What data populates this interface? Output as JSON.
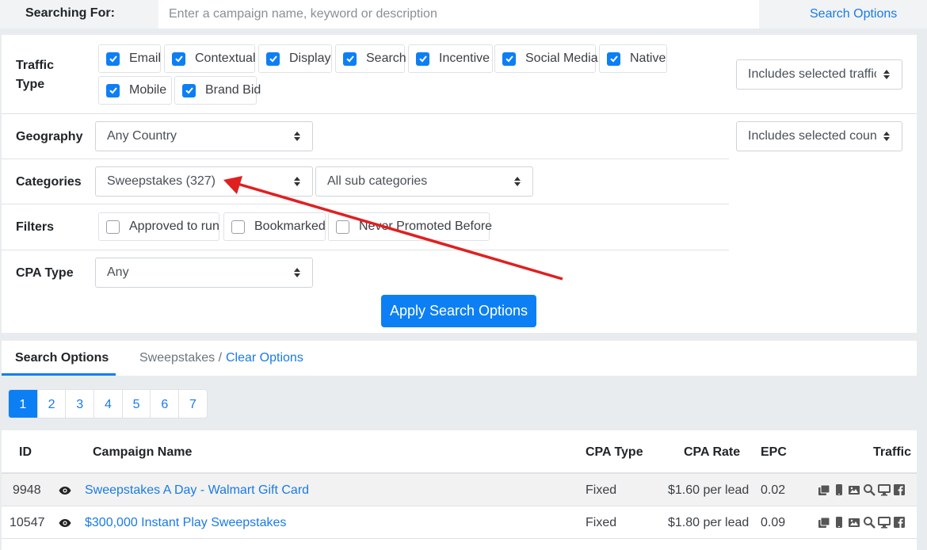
{
  "search_bar": {
    "label": "Searching For:",
    "placeholder": "Enter a campaign name, keyword or description",
    "options_link": "Search Options"
  },
  "filters": {
    "traffic_type": {
      "label_line1": "Traffic",
      "label_line2": "Type",
      "options": [
        {
          "label": "Email",
          "checked": true
        },
        {
          "label": "Contextual",
          "checked": true
        },
        {
          "label": "Display",
          "checked": true
        },
        {
          "label": "Search",
          "checked": true
        },
        {
          "label": "Incentive",
          "checked": true
        },
        {
          "label": "Social Media",
          "checked": true
        },
        {
          "label": "Native",
          "checked": true
        },
        {
          "label": "Mobile",
          "checked": true
        },
        {
          "label": "Brand Bid",
          "checked": true
        }
      ],
      "mode_select": "Includes selected traffic types"
    },
    "geography": {
      "label": "Geography",
      "select": "Any Country",
      "mode_select": "Includes selected countries"
    },
    "categories": {
      "label": "Categories",
      "select": "Sweepstakes (327)",
      "sub_select": "All sub categories"
    },
    "filters_row": {
      "label": "Filters",
      "options": [
        {
          "label": "Approved to run",
          "checked": false
        },
        {
          "label": "Bookmarked",
          "checked": false
        },
        {
          "label": "Never Promoted Before",
          "checked": false
        }
      ]
    },
    "cpa_type": {
      "label": "CPA Type",
      "select": "Any"
    },
    "apply_button": "Apply Search Options"
  },
  "tabs": {
    "active": "Search Options",
    "crumb": "Sweepstakes /",
    "clear": "Clear Options"
  },
  "pagination": {
    "pages": [
      "1",
      "2",
      "3",
      "4",
      "5",
      "6",
      "7"
    ],
    "current": "1"
  },
  "table": {
    "headers": {
      "id": "ID",
      "name": "Campaign Name",
      "cpa_type": "CPA Type",
      "cpa_rate": "CPA Rate",
      "epc": "EPC",
      "traffic": "Traffic"
    },
    "rows": [
      {
        "id": "9948",
        "name": "Sweepstakes A Day - Walmart Gift Card",
        "cpa_type": "Fixed",
        "cpa_rate": "$1.60 per lead",
        "epc": "0.02"
      },
      {
        "id": "10547",
        "name": "$300,000 Instant Play Sweepstakes",
        "cpa_type": "Fixed",
        "cpa_rate": "$1.80 per lead",
        "epc": "0.09"
      }
    ],
    "traffic_icons": [
      "email-icon",
      "mobile-icon",
      "display-image-icon",
      "search-icon",
      "contextual-monitor-icon",
      "facebook-icon"
    ]
  },
  "colors": {
    "accent": "#0d7ff5",
    "link": "#1a7be5",
    "annotation_arrow": "#e02020"
  }
}
